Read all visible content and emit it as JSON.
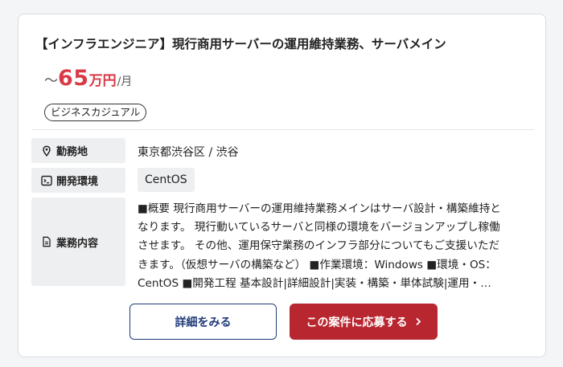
{
  "job": {
    "title": "【インフラエンジニア】現行商用サーバーの運用維持業務、サーバメイン",
    "salary": {
      "prefix": "～",
      "amount": "65",
      "unit": "万円",
      "period": "/月"
    },
    "tag": "ビジネスカジュアル",
    "location": {
      "label": "勤務地",
      "value": "東京都渋谷区 / 渋谷"
    },
    "environment": {
      "label": "開発環境",
      "value": "CentOS"
    },
    "description": {
      "label": "業務内容",
      "lines": [
        "■概要 現行商用サーバーの運用維持業務メインはサーバ設計・構築維持と",
        "なります。 現行動いているサーバと同様の環境をバージョンアップし稼働",
        "させます。 その他、運用保守業務のインフラ部分についてもご支援いただ",
        "きます。（仮想サーバの構築など） ■作業環境：Windows ■環境・OS：",
        "CentOS ■開発工程 基本設計|詳細設計|実装・構築・単体試験|運用・…"
      ]
    },
    "buttons": {
      "detail": "詳細をみる",
      "apply": "この案件に応募する"
    }
  },
  "colors": {
    "salary": "#d83a47",
    "apply_button": "#b8262f",
    "detail_button_border": "#1e3a78"
  },
  "icons": {
    "location": "map-pin-icon",
    "environment": "terminal-icon",
    "description": "document-icon",
    "apply": "chevron-right-icon"
  }
}
